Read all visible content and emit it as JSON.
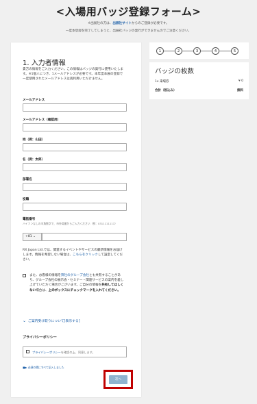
{
  "page": {
    "title": "<入場用バッジ登録フォーム>",
    "notice_line1_prefix": "※出展社の方は、",
    "notice_line1_link": "出展社サイト",
    "notice_line1_suffix": "からのご登録が必要です。",
    "notice_line2": "一度本登録を完了してしまうと、出展社バッジの発行ができませんのでご注意ください。"
  },
  "steps": [
    "1",
    "2",
    "3",
    "4",
    "5"
  ],
  "section": {
    "title": "1. 入力者情報",
    "intro": "貴方の情報をご入力ください。この情報はバッジの発行に使用いたします。※1個人につき、1メールアドレスが必要です。本年度本展の登録で一度使用されたメールアドレスは再利用いただけません。"
  },
  "fields": {
    "email_label": "メールアドレス",
    "email_confirm_label": "メールアドレス（確認用）",
    "last_name_label": "姓（例：山田）",
    "first_name_label": "名（例：太郎）",
    "department_label": "部署名",
    "position_label": "役職",
    "phone_label": "電話番号",
    "phone_hint": "ハイフンなしの半角数字で、市外局番からご入力ください（例：0311111111）",
    "country_code": "+81 ⌄"
  },
  "rx_notice": {
    "text": "RX Japan Ltd.では、関連するイベントやサービスの最新情報をお届けします。情報を希望しない場合は、",
    "link": "こちらをクリック",
    "suffix": "して設定してください。"
  },
  "consent": {
    "prefix": "また、お客様の情報を",
    "link": "弊社のグループ会社",
    "middle": "とも共有することがあり、グループ会社の展示会・セミナー・関連サービスの案内を差し上げていただく場合がございます。ご自分の情報を",
    "bold1": "共有してほしくない",
    "middle2": "場合は、",
    "bold2": "上のボックスにチェックマークを入れてください。"
  },
  "toggle_label": "ご案内受け取りについて[表示する]",
  "privacy": {
    "heading": "プライバシーポリシー",
    "link": "プライバシーポリシー",
    "agree_suffix": "を確認の上、同意します。"
  },
  "required_note": "■▶ 必須の欄にすべて記入しました",
  "next_button": "次へ",
  "badges": {
    "title": "バッジの枚数",
    "row_label": "1x 来場券",
    "row_value": "¥ 0",
    "total_label": "合計（税込み）",
    "total_value": "無料"
  }
}
